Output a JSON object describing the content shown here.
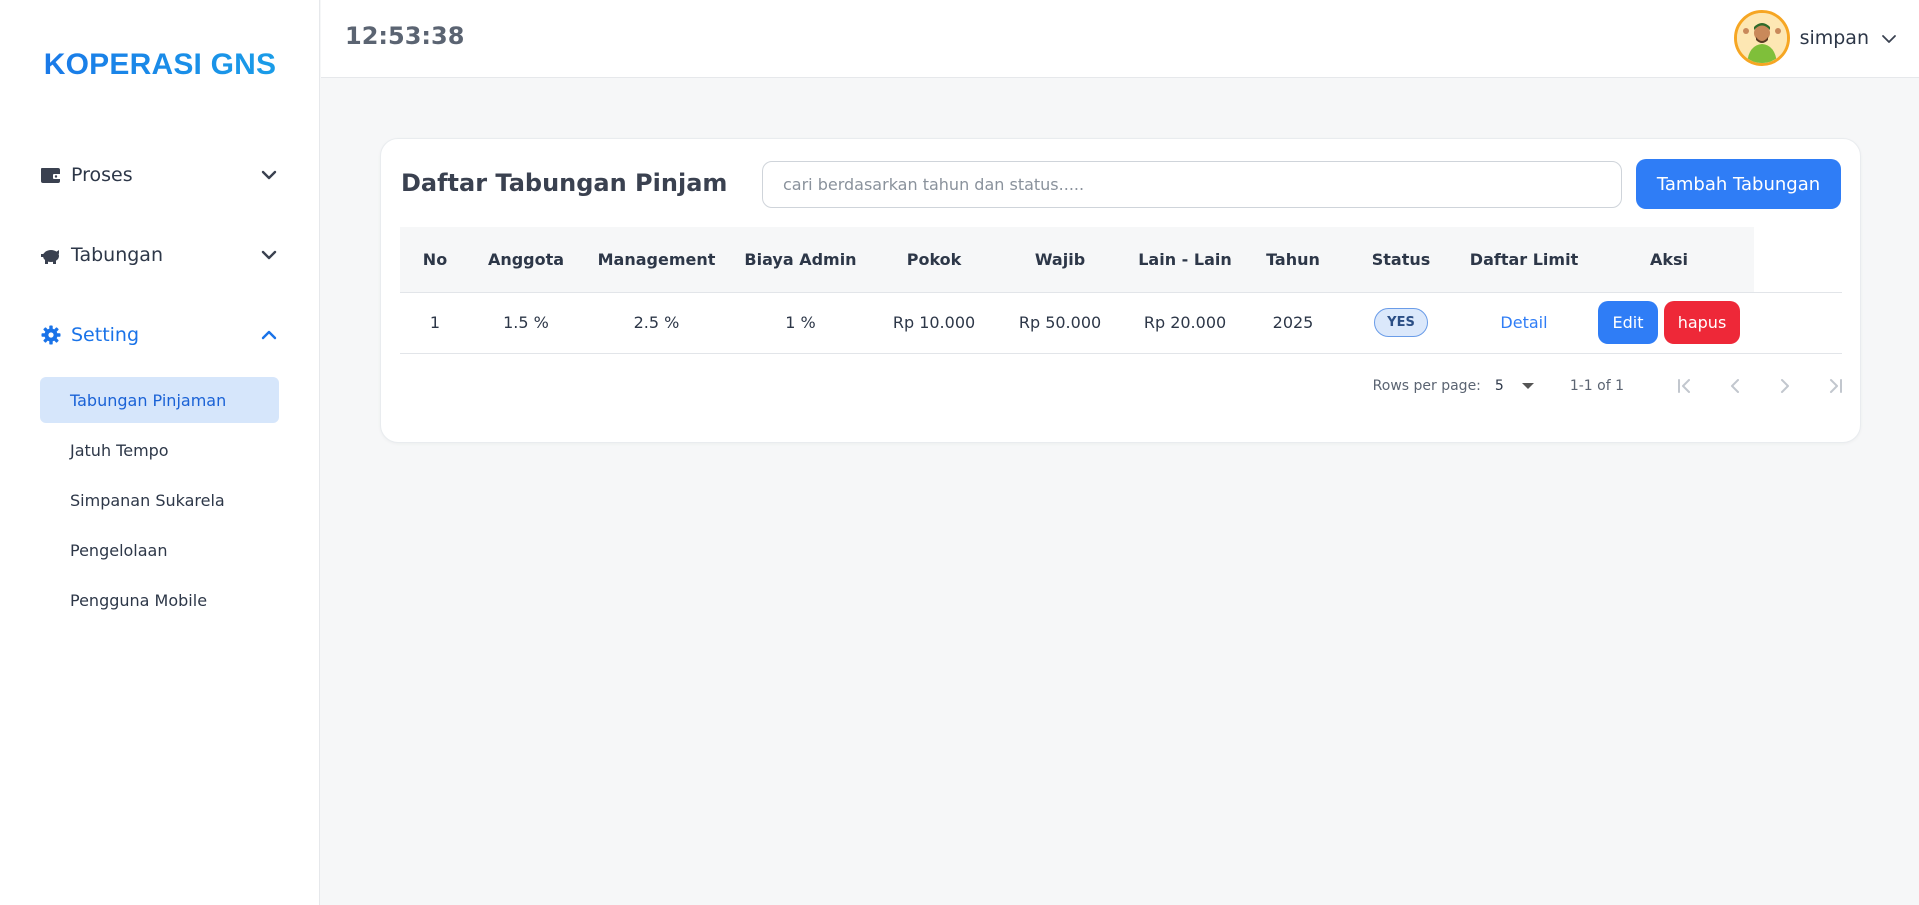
{
  "brand": "KOPERASI GNS",
  "header": {
    "time": "12:53:38",
    "user": "simpan"
  },
  "sidebar": {
    "groups": [
      {
        "label": "Proses",
        "icon": "wallet-icon",
        "expanded": false
      },
      {
        "label": "Tabungan",
        "icon": "piggy-bank-icon",
        "expanded": false
      },
      {
        "label": "Setting",
        "icon": "gear-icon",
        "expanded": true
      }
    ],
    "items": [
      {
        "label": "Tabungan Pinjaman",
        "active": true
      },
      {
        "label": "Jatuh Tempo",
        "active": false
      },
      {
        "label": "Simpanan Sukarela",
        "active": false
      },
      {
        "label": "Pengelolaan",
        "active": false
      },
      {
        "label": "Pengguna Mobile",
        "active": false
      }
    ]
  },
  "card": {
    "title": "Daftar Tabungan Pinjam",
    "search_placeholder": "cari berdasarkan tahun dan status.....",
    "search_value": "",
    "add_button": "Tambah Tabungan"
  },
  "table": {
    "columns": [
      "No",
      "Anggota",
      "Management",
      "Biaya Admin",
      "Pokok",
      "Wajib",
      "Lain - Lain",
      "Tahun",
      "Status",
      "Daftar Limit",
      "Aksi"
    ],
    "rows": [
      {
        "no": "1",
        "anggota": "1.5 %",
        "management": "2.5 %",
        "biaya_admin": "1 %",
        "pokok": "Rp 10.000",
        "wajib": "Rp 50.000",
        "lain": "Rp 20.000",
        "tahun": "2025",
        "status": "YES",
        "limit": "Detail",
        "edit": "Edit",
        "delete": "hapus"
      }
    ]
  },
  "pagination": {
    "rows_per_page_label": "Rows per page:",
    "rows_per_page": "5",
    "range": "1-1 of 1"
  },
  "colors": {
    "primary": "#2f7df6",
    "danger": "#ee2838",
    "active_bg": "#d6e6fb"
  }
}
